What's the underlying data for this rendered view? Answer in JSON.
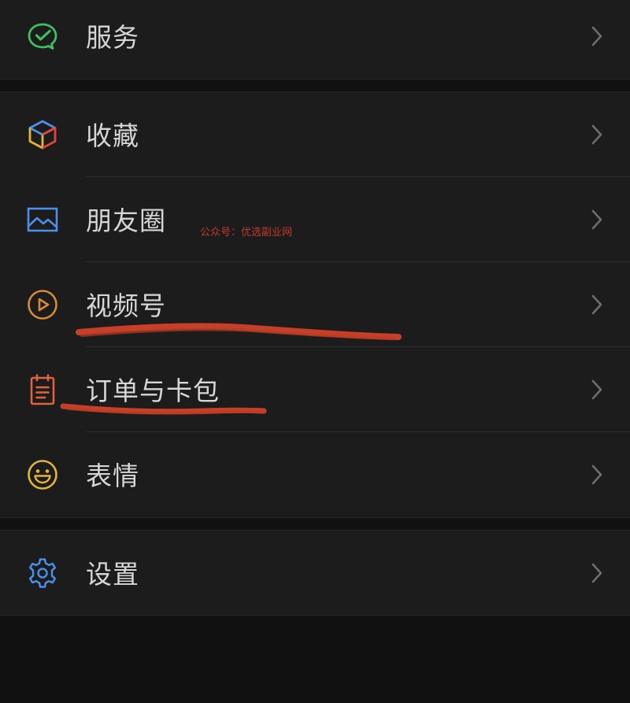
{
  "menu": {
    "group1": {
      "items": [
        {
          "label": "服务",
          "icon": "wechat-pay-icon"
        }
      ]
    },
    "group2": {
      "items": [
        {
          "label": "收藏",
          "icon": "favorites-cube-icon"
        },
        {
          "label": "朋友圈",
          "icon": "moments-image-icon"
        },
        {
          "label": "视频号",
          "icon": "channels-play-icon"
        },
        {
          "label": "订单与卡包",
          "icon": "orders-clipboard-icon"
        },
        {
          "label": "表情",
          "icon": "sticker-smile-icon"
        }
      ]
    },
    "group3": {
      "items": [
        {
          "label": "设置",
          "icon": "settings-gear-icon"
        }
      ]
    }
  },
  "watermark": "公众号：优选副业网",
  "colors": {
    "background": "#111111",
    "row_background": "#1c1c1c",
    "label": "#d6d6d6",
    "chevron": "#6e6e6e",
    "annotation_red": "#d9452b",
    "green": "#3fbf5f",
    "blue": "#4a8fe8",
    "orange": "#d88a3a",
    "red_orange": "#e0633f",
    "yellow": "#e5b53a"
  }
}
